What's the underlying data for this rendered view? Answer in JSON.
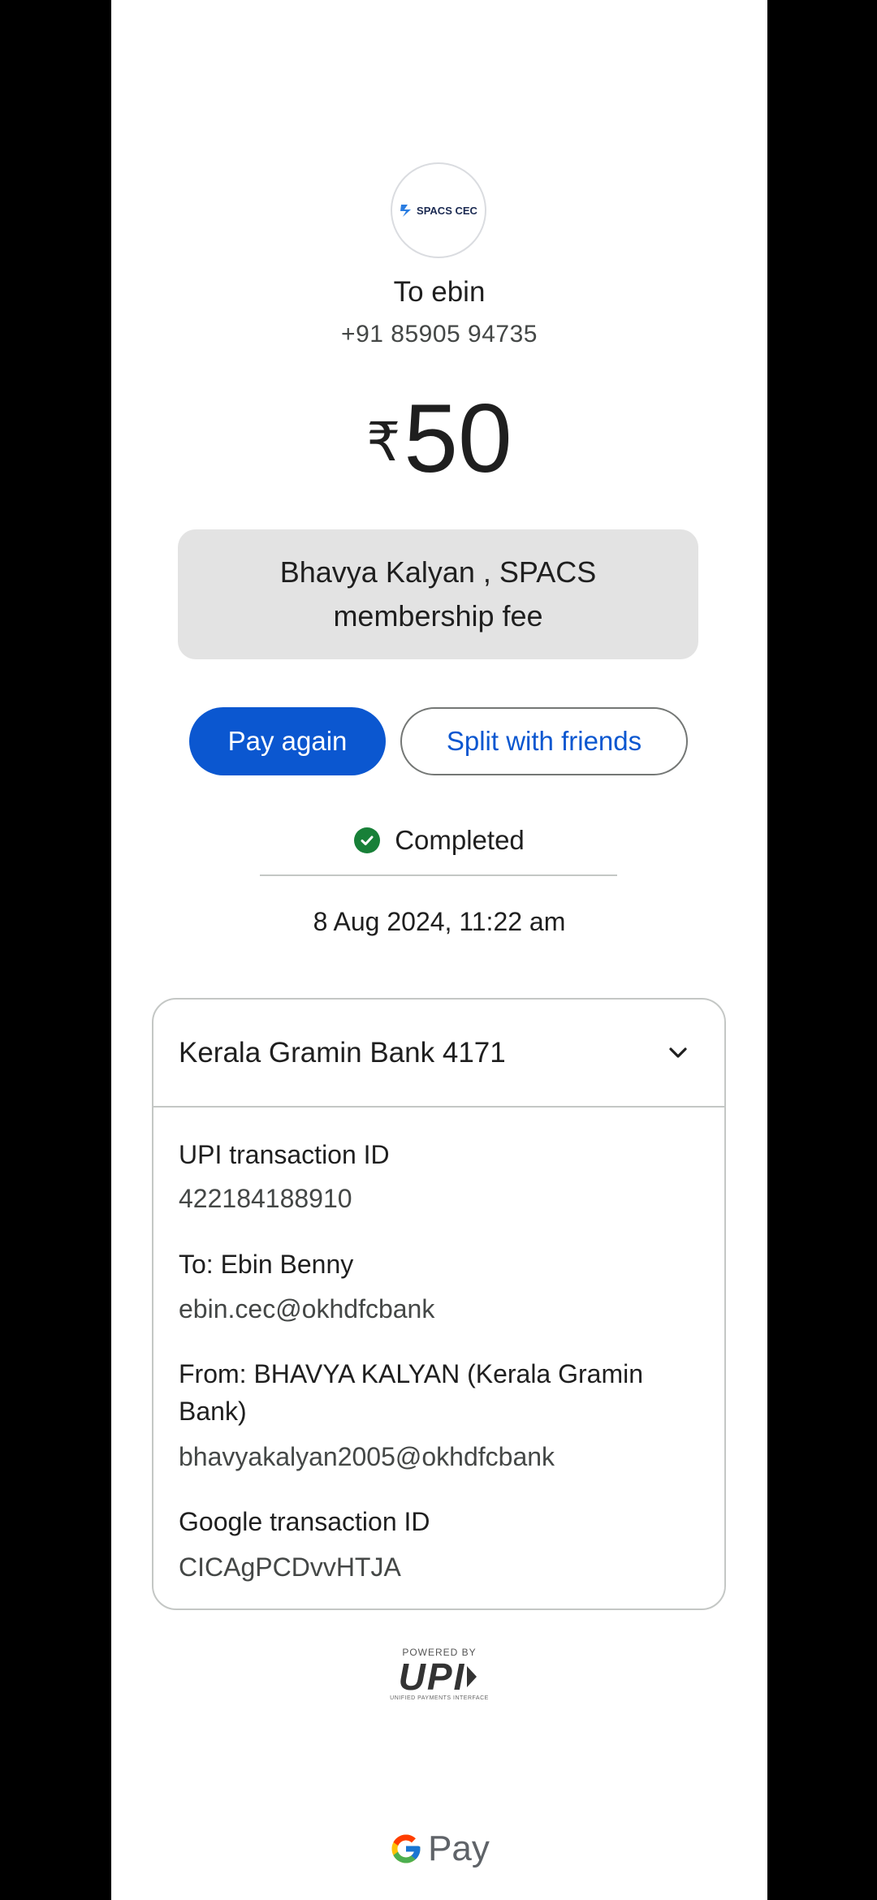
{
  "recipient": {
    "avatar_text": "SPACS CEC",
    "name_line": "To ebin",
    "phone": "+91 85905 94735"
  },
  "payment": {
    "currency_symbol": "₹",
    "amount": "50",
    "note": "Bhavya Kalyan , SPACS membership fee"
  },
  "actions": {
    "pay_again": "Pay again",
    "split": "Split with friends"
  },
  "status": {
    "label": "Completed",
    "color": "#188038",
    "datetime": "8 Aug 2024, 11:22 am"
  },
  "details": {
    "bank_account": "Kerala Gramin Bank 4171",
    "upi_txn_label": "UPI transaction ID",
    "upi_txn_value": "422184188910",
    "to_label": "To: Ebin  Benny",
    "to_value": "ebin.cec@okhdfcbank",
    "from_label": "From: BHAVYA KALYAN (Kerala Gramin Bank)",
    "from_value": "bhavyakalyan2005@okhdfcbank",
    "google_txn_label": "Google transaction ID",
    "google_txn_value": "CICAgPCDvvHTJA"
  },
  "footer": {
    "powered_by": "POWERED BY",
    "upi": "UPI",
    "upi_sub": "UNIFIED PAYMENTS INTERFACE",
    "gpay": "Pay"
  },
  "colors": {
    "primary": "#0b57d0",
    "note_bg": "#e3e3e3"
  },
  "icons": {
    "status": "check-circle-icon",
    "expand": "chevron-down-icon",
    "brand": "google-g-icon"
  }
}
